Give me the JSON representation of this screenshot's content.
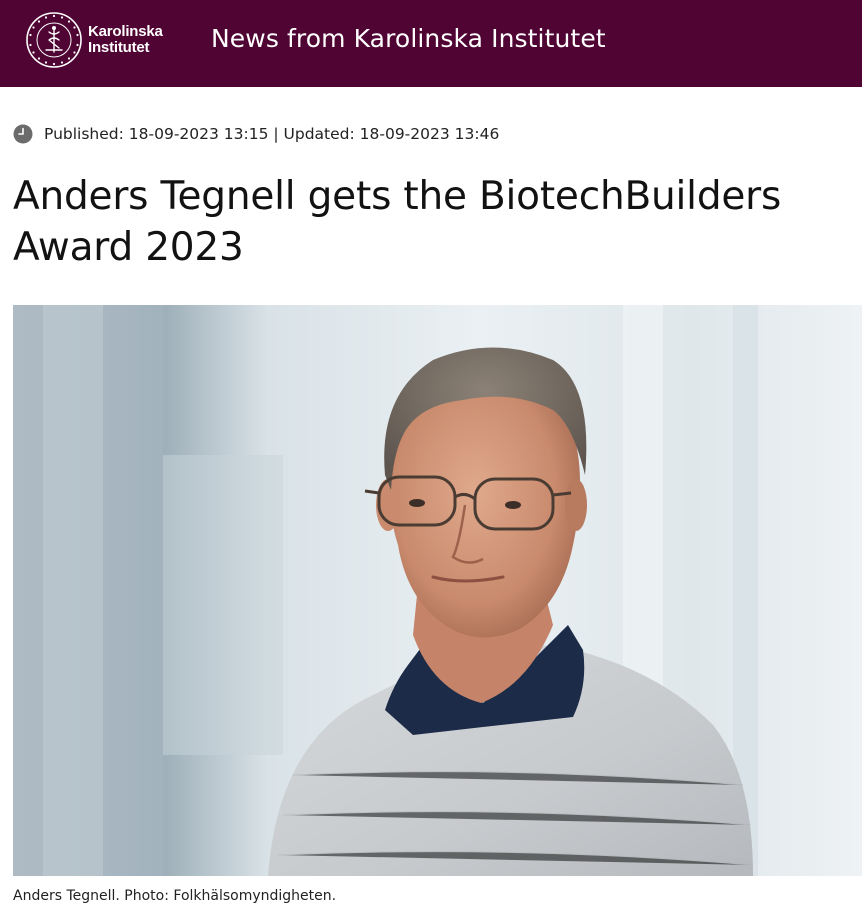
{
  "header": {
    "logo_line1": "Karolinska",
    "logo_line2": "Institutet",
    "site_title": "News from Karolinska Institutet"
  },
  "article": {
    "meta": "Published: 18-09-2023 13:15 | Updated: 18-09-2023 13:46",
    "title_line1": "Anders Tegnell gets the BiotechBuilders",
    "title_line2": "Award 2023",
    "image_caption": "Anders Tegnell. Photo: Folkhälsomyndigheten."
  },
  "icons": {
    "seal": "karolinska-seal-icon",
    "clock": "clock-icon"
  },
  "colors": {
    "brand": "#4f0433",
    "header_text": "#ffffff"
  }
}
